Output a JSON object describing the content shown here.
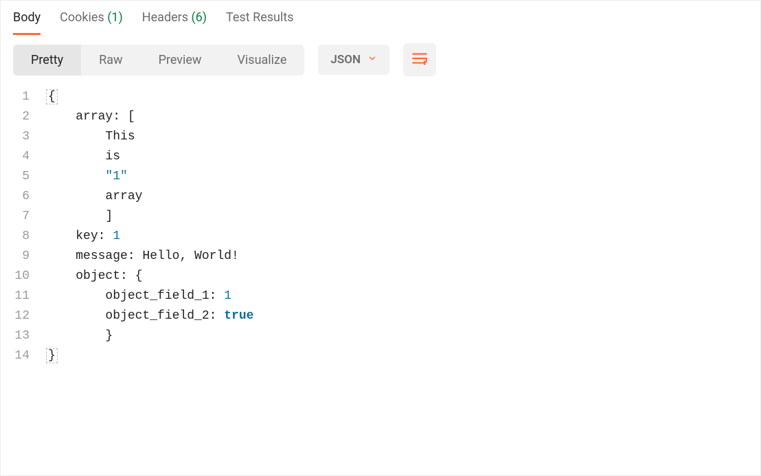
{
  "response_tabs": {
    "body": "Body",
    "cookies_label": "Cookies",
    "cookies_count": "(1)",
    "headers_label": "Headers",
    "headers_count": "(6)",
    "test_results": "Test Results"
  },
  "view_modes": {
    "pretty": "Pretty",
    "raw": "Raw",
    "preview": "Preview",
    "visualize": "Visualize"
  },
  "type_select": {
    "selected": "JSON"
  },
  "code": {
    "lines": [
      {
        "n": "1",
        "indent": "",
        "segments": [
          {
            "cls": "brace",
            "t": "{"
          }
        ]
      },
      {
        "n": "2",
        "indent": "    ",
        "segments": [
          {
            "t": "array: ["
          }
        ]
      },
      {
        "n": "3",
        "indent": "        ",
        "segments": [
          {
            "t": "This"
          }
        ]
      },
      {
        "n": "4",
        "indent": "        ",
        "segments": [
          {
            "t": "is"
          }
        ]
      },
      {
        "n": "5",
        "indent": "        ",
        "segments": [
          {
            "cls": "str",
            "t": "\"1\""
          }
        ]
      },
      {
        "n": "6",
        "indent": "        ",
        "segments": [
          {
            "t": "array"
          }
        ]
      },
      {
        "n": "7",
        "indent": "        ",
        "segments": [
          {
            "t": "]"
          }
        ]
      },
      {
        "n": "8",
        "indent": "    ",
        "segments": [
          {
            "t": "key: "
          },
          {
            "cls": "num",
            "t": "1"
          }
        ]
      },
      {
        "n": "9",
        "indent": "    ",
        "segments": [
          {
            "t": "message: Hello, World!"
          }
        ]
      },
      {
        "n": "10",
        "indent": "    ",
        "segments": [
          {
            "t": "object: {"
          }
        ]
      },
      {
        "n": "11",
        "indent": "        ",
        "segments": [
          {
            "t": "object_field_1: "
          },
          {
            "cls": "num",
            "t": "1"
          }
        ]
      },
      {
        "n": "12",
        "indent": "        ",
        "segments": [
          {
            "t": "object_field_2: "
          },
          {
            "cls": "bool",
            "t": "true"
          }
        ]
      },
      {
        "n": "13",
        "indent": "        ",
        "segments": [
          {
            "t": "}"
          }
        ]
      },
      {
        "n": "14",
        "indent": "",
        "segments": [
          {
            "cls": "brace",
            "t": "}"
          }
        ]
      }
    ]
  }
}
